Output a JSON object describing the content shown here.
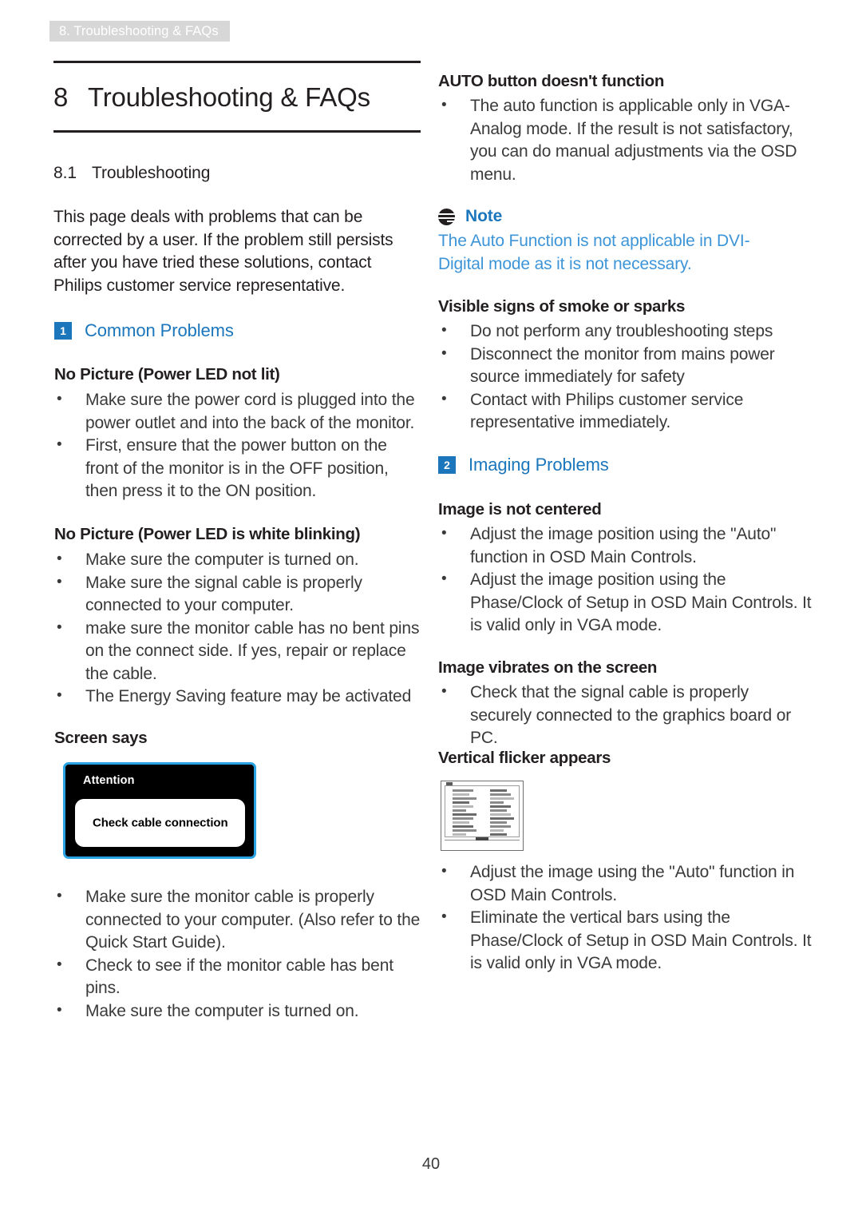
{
  "header": {
    "running_tab": "8. Troubleshooting & FAQs"
  },
  "chapter": {
    "number": "8",
    "title": "Troubleshooting & FAQs"
  },
  "section": {
    "number": "8.1",
    "title": "Troubleshooting",
    "intro": "This page deals with problems that can be corrected by a user. If the problem still persists after you have tried these solutions, contact Philips customer service representative."
  },
  "groups": [
    {
      "badge": "1",
      "label": "Common Problems"
    },
    {
      "badge": "2",
      "label": "Imaging Problems"
    }
  ],
  "left_column": {
    "topic_no_picture_led_not_lit": {
      "heading": "No Picture (Power LED not lit)",
      "bullets": [
        "Make sure the power cord is plugged into the power outlet and into the back of the monitor.",
        "First, ensure that the power button on the front of the monitor is in the OFF position, then press it to the ON position."
      ]
    },
    "topic_no_picture_led_blinking": {
      "heading": "No Picture (Power LED is white blinking)",
      "bullets": [
        "Make sure the computer is turned on.",
        "Make sure the signal cable is properly connected to your computer.",
        "make sure the monitor cable has no bent pins on the connect side. If yes, repair or replace the cable.",
        "The Energy Saving feature may be activated"
      ]
    },
    "topic_screen_says": {
      "heading": "Screen says",
      "figure": {
        "title": "Attention",
        "message": "Check cable connection",
        "border_color": "#29a3e3",
        "background_color": "#000000"
      },
      "bullets": [
        "Make sure the monitor cable is properly connected to your computer. (Also refer to the Quick Start Guide).",
        "Check to see if the monitor cable has bent pins.",
        "Make sure the computer is turned on."
      ]
    }
  },
  "right_column": {
    "topic_auto_button": {
      "heading": "AUTO button doesn't function",
      "bullets": [
        "The auto function is applicable only in VGA-Analog mode.  If the result is not satisfactory, you can do manual adjustments via the OSD menu."
      ]
    },
    "note": {
      "icon": "note-icon",
      "title": "Note",
      "body": "The Auto Function is not applicable in DVI-Digital mode as it is not necessary.",
      "title_color": "#1b76bc",
      "body_color": "#3d95d8"
    },
    "topic_smoke_sparks": {
      "heading": "Visible signs of smoke or sparks",
      "bullets": [
        "Do not perform any troubleshooting steps",
        "Disconnect the monitor from mains power source immediately for safety",
        "Contact with Philips customer service representative immediately."
      ]
    },
    "topic_not_centered": {
      "heading": "Image is not centered",
      "bullets": [
        "Adjust the image position using the \"Auto\" function in OSD Main Controls.",
        "Adjust the image position using the Phase/Clock of Setup in OSD Main Controls.  It is valid only in VGA mode."
      ]
    },
    "topic_vibrates": {
      "heading": "Image vibrates on the screen",
      "bullets": [
        "Check that the signal cable is properly securely connected to the graphics board or PC."
      ]
    },
    "topic_vertical_flicker": {
      "heading": "Vertical flicker appears",
      "bullets": [
        "Adjust the image using the \"Auto\" function in OSD Main Controls.",
        "Eliminate the vertical bars using the Phase/Clock of Setup in OSD Main Controls. It is valid only in VGA mode."
      ]
    }
  },
  "footer": {
    "page_number": "40"
  },
  "theme": {
    "accent_blue": "#1b76bc",
    "note_blue": "#3d95d8",
    "tab_gray": "#d7d7d7",
    "text": "#231f20"
  }
}
